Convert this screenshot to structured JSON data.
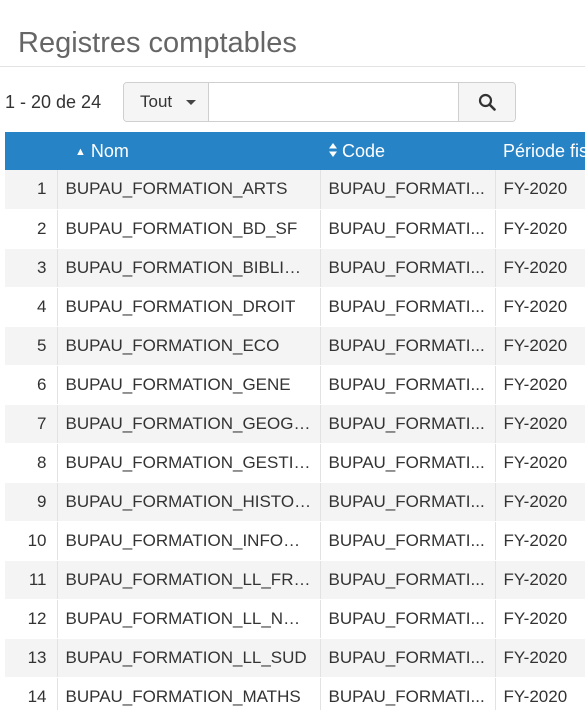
{
  "page": {
    "title": "Registres comptables"
  },
  "toolbar": {
    "range": "1 - 20 de 24",
    "scope": "Tout",
    "search_value": "",
    "search_placeholder": ""
  },
  "table": {
    "columns": [
      {
        "label": "Nom",
        "sort": "asc"
      },
      {
        "label": "Code",
        "sort": "both"
      },
      {
        "label": "Période fis",
        "sort": "none"
      }
    ],
    "rows": [
      {
        "index": "1",
        "nom": "BUPAU_FORMATION_ARTS",
        "code": "BUPAU_FORMATI...",
        "periode": "FY-2020"
      },
      {
        "index": "2",
        "nom": "BUPAU_FORMATION_BD_SF",
        "code": "BUPAU_FORMATI...",
        "periode": "FY-2020"
      },
      {
        "index": "3",
        "nom": "BUPAU_FORMATION_BIBLIOT...",
        "code": "BUPAU_FORMATI...",
        "periode": "FY-2020"
      },
      {
        "index": "4",
        "nom": "BUPAU_FORMATION_DROIT",
        "code": "BUPAU_FORMATI...",
        "periode": "FY-2020"
      },
      {
        "index": "5",
        "nom": "BUPAU_FORMATION_ECO",
        "code": "BUPAU_FORMATI...",
        "periode": "FY-2020"
      },
      {
        "index": "6",
        "nom": "BUPAU_FORMATION_GENE",
        "code": "BUPAU_FORMATI...",
        "periode": "FY-2020"
      },
      {
        "index": "7",
        "nom": "BUPAU_FORMATION_GEOGR...",
        "code": "BUPAU_FORMATI...",
        "periode": "FY-2020"
      },
      {
        "index": "8",
        "nom": "BUPAU_FORMATION_GESTION",
        "code": "BUPAU_FORMATI...",
        "periode": "FY-2020"
      },
      {
        "index": "9",
        "nom": "BUPAU_FORMATION_HISTOIR...",
        "code": "BUPAU_FORMATI...",
        "periode": "FY-2020"
      },
      {
        "index": "10",
        "nom": "BUPAU_FORMATION_INFORM...",
        "code": "BUPAU_FORMATI...",
        "periode": "FY-2020"
      },
      {
        "index": "11",
        "nom": "BUPAU_FORMATION_LL_FRA...",
        "code": "BUPAU_FORMATI...",
        "periode": "FY-2020"
      },
      {
        "index": "12",
        "nom": "BUPAU_FORMATION_LL_NORD",
        "code": "BUPAU_FORMATI...",
        "periode": "FY-2020"
      },
      {
        "index": "13",
        "nom": "BUPAU_FORMATION_LL_SUD",
        "code": "BUPAU_FORMATI...",
        "periode": "FY-2020"
      },
      {
        "index": "14",
        "nom": "BUPAU_FORMATION_MATHS",
        "code": "BUPAU_FORMATI...",
        "periode": "FY-2020"
      }
    ]
  },
  "colors": {
    "header_bg": "#2683c6",
    "row_alt": "#f4f4f4"
  },
  "icons": {
    "search": "search-icon",
    "dropdown": "chevron-down-icon",
    "sort_asc": "sort-asc-icon",
    "sort_both": "sort-both-icon"
  }
}
